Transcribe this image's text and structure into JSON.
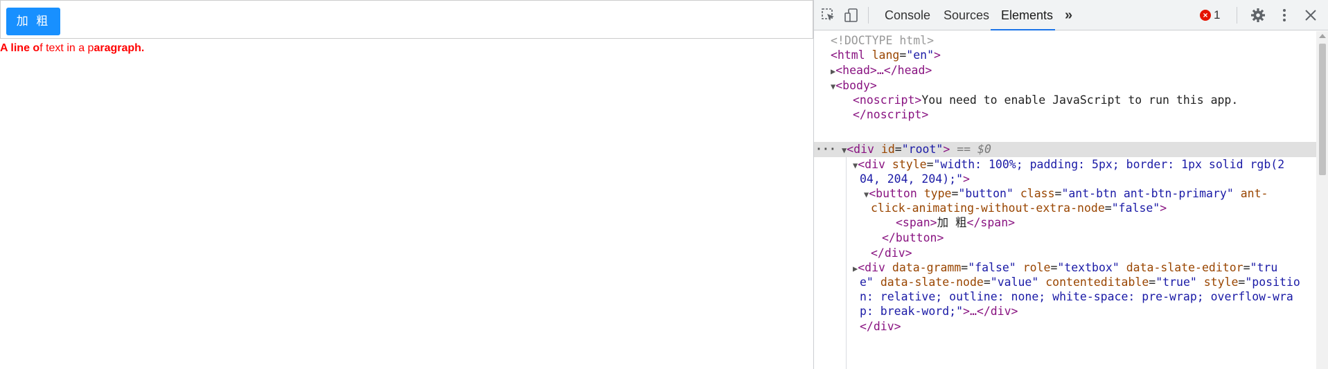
{
  "page": {
    "bold_button_label": "加 粗",
    "paragraph": [
      {
        "text": "A line o",
        "bold": true
      },
      {
        "text": "f text in a p",
        "bold": false
      },
      {
        "text": "aragraph.",
        "bold": true
      }
    ]
  },
  "devtools": {
    "tabs": {
      "console": "Console",
      "sources": "Sources",
      "elements": "Elements",
      "more": "»"
    },
    "error_count": "1",
    "selected_marker": "== $0",
    "tree": {
      "doctype": "<!DOCTYPE html>",
      "html_open": "<html",
      "html_attr": "lang",
      "html_val": "\"en\"",
      "head": "<head>…</head>",
      "body_open": "<body>",
      "noscript_open": "<noscript>",
      "noscript_text": "You need to enable JavaScript to run this app.",
      "noscript_close": "</noscript>",
      "root_open": "<div",
      "root_attr": "id",
      "root_val": "\"root\"",
      "div_style_open": "<div",
      "div_style_attr": "style",
      "div_style_val_1": "\"width: 100%; padding: 5px; border: 1px solid rgb(2",
      "div_style_val_2": "04, 204, 204);\"",
      "button_open": "<button",
      "button_attr_type": "type",
      "button_val_type": "\"button\"",
      "button_attr_class": "class",
      "button_val_class": "\"ant-btn ant-btn-primary\"",
      "button_attr_ant_1": "ant-",
      "button_attr_ant_2": "click-animating-without-extra-node",
      "button_val_ant": "\"false\"",
      "span_open": "<span>",
      "span_text": "加 粗",
      "span_close": "</span>",
      "button_close": "</button>",
      "div_close": "</div>",
      "editor_open": "<div",
      "editor_a1": "data-gramm",
      "editor_v1": "\"false\"",
      "editor_a2": "role",
      "editor_v2": "\"textbox\"",
      "editor_a3": "data-slate-editor",
      "editor_v3a": "\"tru",
      "editor_v3b": "e\"",
      "editor_a4": "data-slate-node",
      "editor_v4": "\"value\"",
      "editor_a5": "contenteditable",
      "editor_v5": "\"true\"",
      "editor_a6": "style",
      "editor_v6a": "\"positio",
      "editor_v6b": "n: relative; outline: none; white-space: pre-wrap; overflow-wra",
      "editor_v6c": "p: break-word;\"",
      "editor_tail": ">…</div>",
      "root_close": "</div>"
    }
  }
}
